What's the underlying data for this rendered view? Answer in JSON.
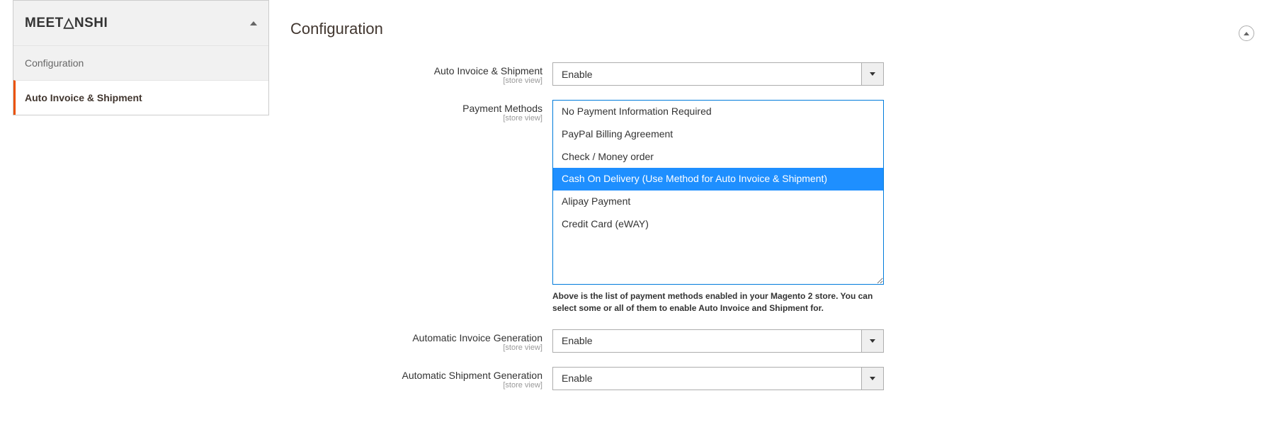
{
  "sidebar": {
    "brand": "MEET△NSHI",
    "items": [
      {
        "label": "Configuration"
      },
      {
        "label": "Auto Invoice & Shipment"
      }
    ]
  },
  "page": {
    "title": "Configuration"
  },
  "fields": {
    "auto_invoice_shipment": {
      "label": "Auto Invoice & Shipment",
      "scope": "[store view]",
      "value": "Enable"
    },
    "payment_methods": {
      "label": "Payment Methods",
      "scope": "[store view]",
      "options": [
        "No Payment Information Required",
        "PayPal Billing Agreement",
        "Check / Money order",
        "Cash On Delivery (Use Method for Auto Invoice & Shipment)",
        "Alipay Payment",
        "Credit Card (eWAY)"
      ],
      "selected_index": 3,
      "note": "Above is the list of payment methods enabled in your Magento 2 store. You can select some or all of them to enable Auto Invoice and Shipment for."
    },
    "auto_invoice_gen": {
      "label": "Automatic Invoice Generation",
      "scope": "[store view]",
      "value": "Enable"
    },
    "auto_shipment_gen": {
      "label": "Automatic Shipment Generation",
      "scope": "[store view]",
      "value": "Enable"
    }
  }
}
